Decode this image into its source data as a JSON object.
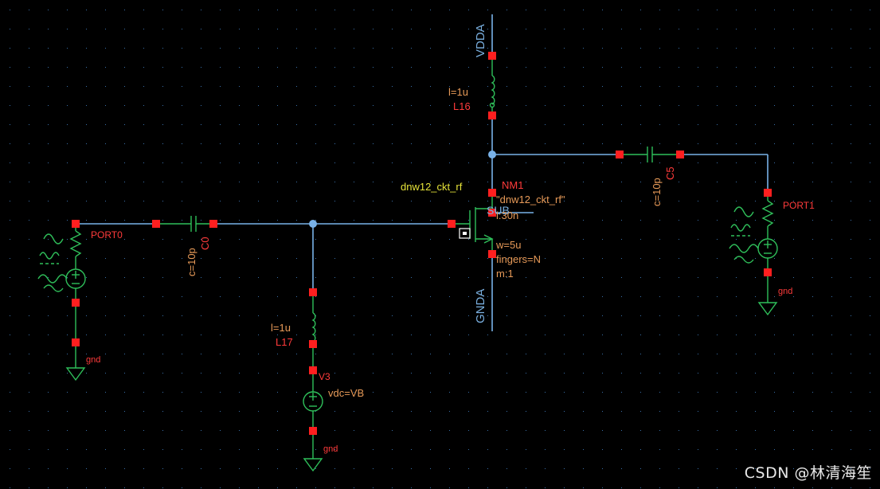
{
  "colors": {
    "background": "#000000",
    "wire": "#79b2e8",
    "pin": "#ff1f1f",
    "symbol": "#2fbf5a",
    "label_red": "#ff3b3b",
    "label_orange": "#e79a58",
    "label_yellow": "#e6e43a",
    "net_label": "#7ab0e0",
    "grid_dot": "#3a6fa8"
  },
  "schematic": {
    "nets": {
      "supply": "VDDA",
      "ground": "GNDA"
    },
    "transistor": {
      "instance": "NM1",
      "cell": "dnw12_ckt_rf",
      "model": "\"dnw12_ckt_rf\"",
      "length": "l:30n",
      "width": "w=5u",
      "fingers": "fingers=N",
      "multiplier": "m:1",
      "sub_label": "SUB"
    },
    "inductors": [
      {
        "name": "L16",
        "value": "l=1u"
      },
      {
        "name": "L17",
        "value": "l=1u"
      }
    ],
    "capacitors": [
      {
        "name": "C0",
        "value": "c=10p"
      },
      {
        "name": "C5",
        "value": "c=10p"
      }
    ],
    "ports": [
      {
        "name": "PORT0",
        "ground": "gnd"
      },
      {
        "name": "PORT1",
        "ground": "gnd"
      }
    ],
    "vsource": {
      "name": "V3",
      "value": "vdc=VB",
      "ground": "gnd"
    }
  },
  "watermark": "CSDN @林清海笙"
}
